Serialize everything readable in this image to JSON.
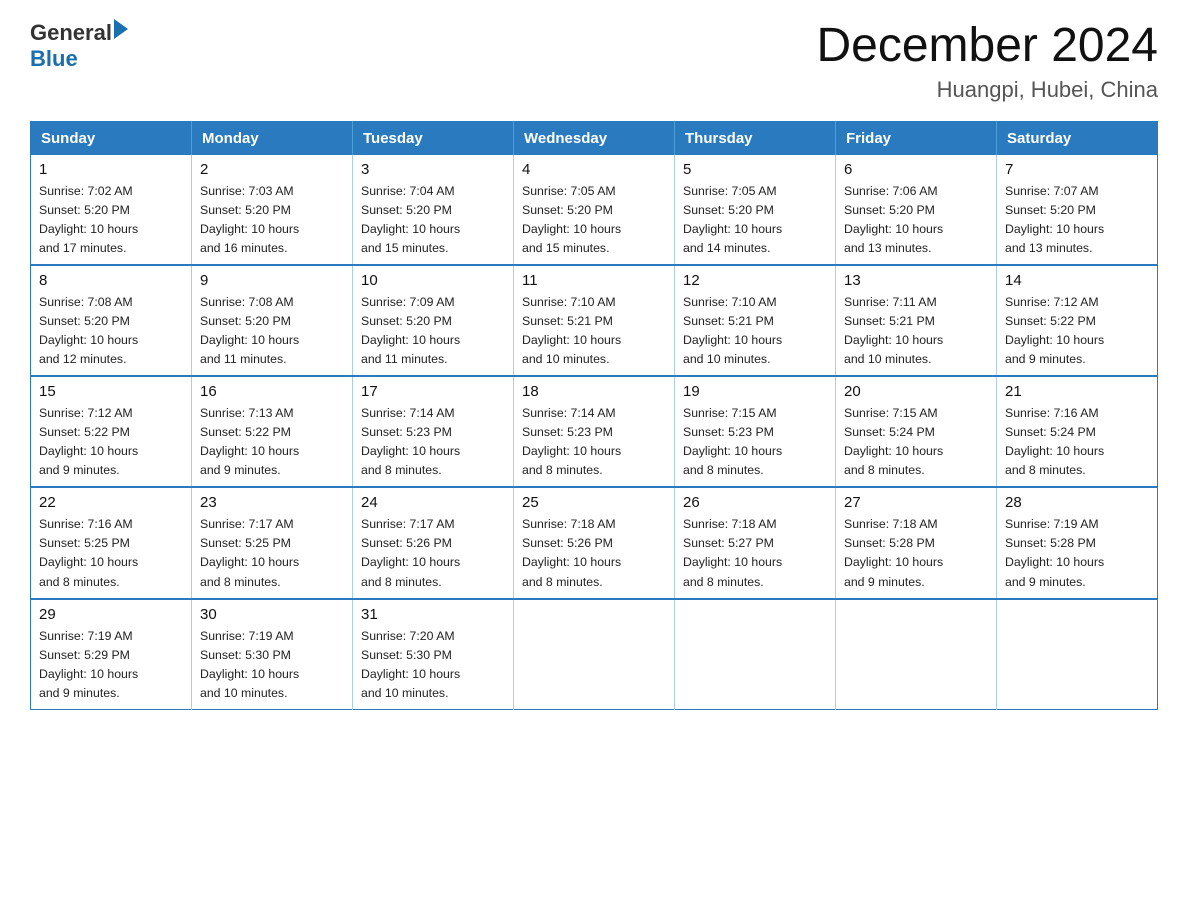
{
  "logo": {
    "text_general": "General",
    "text_blue": "Blue",
    "arrow": "▶"
  },
  "title": "December 2024",
  "location": "Huangpi, Hubei, China",
  "days_of_week": [
    "Sunday",
    "Monday",
    "Tuesday",
    "Wednesday",
    "Thursday",
    "Friday",
    "Saturday"
  ],
  "weeks": [
    [
      {
        "day": "1",
        "sunrise": "7:02 AM",
        "sunset": "5:20 PM",
        "daylight": "10 hours and 17 minutes."
      },
      {
        "day": "2",
        "sunrise": "7:03 AM",
        "sunset": "5:20 PM",
        "daylight": "10 hours and 16 minutes."
      },
      {
        "day": "3",
        "sunrise": "7:04 AM",
        "sunset": "5:20 PM",
        "daylight": "10 hours and 15 minutes."
      },
      {
        "day": "4",
        "sunrise": "7:05 AM",
        "sunset": "5:20 PM",
        "daylight": "10 hours and 15 minutes."
      },
      {
        "day": "5",
        "sunrise": "7:05 AM",
        "sunset": "5:20 PM",
        "daylight": "10 hours and 14 minutes."
      },
      {
        "day": "6",
        "sunrise": "7:06 AM",
        "sunset": "5:20 PM",
        "daylight": "10 hours and 13 minutes."
      },
      {
        "day": "7",
        "sunrise": "7:07 AM",
        "sunset": "5:20 PM",
        "daylight": "10 hours and 13 minutes."
      }
    ],
    [
      {
        "day": "8",
        "sunrise": "7:08 AM",
        "sunset": "5:20 PM",
        "daylight": "10 hours and 12 minutes."
      },
      {
        "day": "9",
        "sunrise": "7:08 AM",
        "sunset": "5:20 PM",
        "daylight": "10 hours and 11 minutes."
      },
      {
        "day": "10",
        "sunrise": "7:09 AM",
        "sunset": "5:20 PM",
        "daylight": "10 hours and 11 minutes."
      },
      {
        "day": "11",
        "sunrise": "7:10 AM",
        "sunset": "5:21 PM",
        "daylight": "10 hours and 10 minutes."
      },
      {
        "day": "12",
        "sunrise": "7:10 AM",
        "sunset": "5:21 PM",
        "daylight": "10 hours and 10 minutes."
      },
      {
        "day": "13",
        "sunrise": "7:11 AM",
        "sunset": "5:21 PM",
        "daylight": "10 hours and 10 minutes."
      },
      {
        "day": "14",
        "sunrise": "7:12 AM",
        "sunset": "5:22 PM",
        "daylight": "10 hours and 9 minutes."
      }
    ],
    [
      {
        "day": "15",
        "sunrise": "7:12 AM",
        "sunset": "5:22 PM",
        "daylight": "10 hours and 9 minutes."
      },
      {
        "day": "16",
        "sunrise": "7:13 AM",
        "sunset": "5:22 PM",
        "daylight": "10 hours and 9 minutes."
      },
      {
        "day": "17",
        "sunrise": "7:14 AM",
        "sunset": "5:23 PM",
        "daylight": "10 hours and 8 minutes."
      },
      {
        "day": "18",
        "sunrise": "7:14 AM",
        "sunset": "5:23 PM",
        "daylight": "10 hours and 8 minutes."
      },
      {
        "day": "19",
        "sunrise": "7:15 AM",
        "sunset": "5:23 PM",
        "daylight": "10 hours and 8 minutes."
      },
      {
        "day": "20",
        "sunrise": "7:15 AM",
        "sunset": "5:24 PM",
        "daylight": "10 hours and 8 minutes."
      },
      {
        "day": "21",
        "sunrise": "7:16 AM",
        "sunset": "5:24 PM",
        "daylight": "10 hours and 8 minutes."
      }
    ],
    [
      {
        "day": "22",
        "sunrise": "7:16 AM",
        "sunset": "5:25 PM",
        "daylight": "10 hours and 8 minutes."
      },
      {
        "day": "23",
        "sunrise": "7:17 AM",
        "sunset": "5:25 PM",
        "daylight": "10 hours and 8 minutes."
      },
      {
        "day": "24",
        "sunrise": "7:17 AM",
        "sunset": "5:26 PM",
        "daylight": "10 hours and 8 minutes."
      },
      {
        "day": "25",
        "sunrise": "7:18 AM",
        "sunset": "5:26 PM",
        "daylight": "10 hours and 8 minutes."
      },
      {
        "day": "26",
        "sunrise": "7:18 AM",
        "sunset": "5:27 PM",
        "daylight": "10 hours and 8 minutes."
      },
      {
        "day": "27",
        "sunrise": "7:18 AM",
        "sunset": "5:28 PM",
        "daylight": "10 hours and 9 minutes."
      },
      {
        "day": "28",
        "sunrise": "7:19 AM",
        "sunset": "5:28 PM",
        "daylight": "10 hours and 9 minutes."
      }
    ],
    [
      {
        "day": "29",
        "sunrise": "7:19 AM",
        "sunset": "5:29 PM",
        "daylight": "10 hours and 9 minutes."
      },
      {
        "day": "30",
        "sunrise": "7:19 AM",
        "sunset": "5:30 PM",
        "daylight": "10 hours and 10 minutes."
      },
      {
        "day": "31",
        "sunrise": "7:20 AM",
        "sunset": "5:30 PM",
        "daylight": "10 hours and 10 minutes."
      },
      null,
      null,
      null,
      null
    ]
  ],
  "labels": {
    "sunrise": "Sunrise:",
    "sunset": "Sunset:",
    "daylight": "Daylight:"
  }
}
